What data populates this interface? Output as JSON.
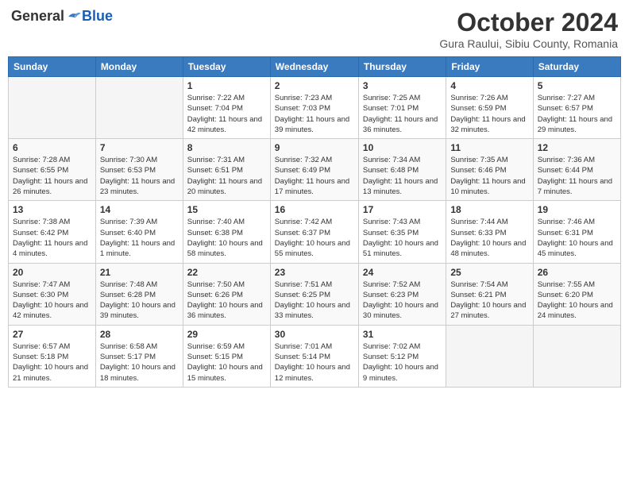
{
  "header": {
    "logo_general": "General",
    "logo_blue": "Blue",
    "month_title": "October 2024",
    "subtitle": "Gura Raului, Sibiu County, Romania"
  },
  "days_of_week": [
    "Sunday",
    "Monday",
    "Tuesday",
    "Wednesday",
    "Thursday",
    "Friday",
    "Saturday"
  ],
  "weeks": [
    [
      {
        "day": "",
        "empty": true
      },
      {
        "day": "",
        "empty": true
      },
      {
        "day": "1",
        "sunrise": "7:22 AM",
        "sunset": "7:04 PM",
        "daylight": "11 hours and 42 minutes."
      },
      {
        "day": "2",
        "sunrise": "7:23 AM",
        "sunset": "7:03 PM",
        "daylight": "11 hours and 39 minutes."
      },
      {
        "day": "3",
        "sunrise": "7:25 AM",
        "sunset": "7:01 PM",
        "daylight": "11 hours and 36 minutes."
      },
      {
        "day": "4",
        "sunrise": "7:26 AM",
        "sunset": "6:59 PM",
        "daylight": "11 hours and 32 minutes."
      },
      {
        "day": "5",
        "sunrise": "7:27 AM",
        "sunset": "6:57 PM",
        "daylight": "11 hours and 29 minutes."
      }
    ],
    [
      {
        "day": "6",
        "sunrise": "7:28 AM",
        "sunset": "6:55 PM",
        "daylight": "11 hours and 26 minutes."
      },
      {
        "day": "7",
        "sunrise": "7:30 AM",
        "sunset": "6:53 PM",
        "daylight": "11 hours and 23 minutes."
      },
      {
        "day": "8",
        "sunrise": "7:31 AM",
        "sunset": "6:51 PM",
        "daylight": "11 hours and 20 minutes."
      },
      {
        "day": "9",
        "sunrise": "7:32 AM",
        "sunset": "6:49 PM",
        "daylight": "11 hours and 17 minutes."
      },
      {
        "day": "10",
        "sunrise": "7:34 AM",
        "sunset": "6:48 PM",
        "daylight": "11 hours and 13 minutes."
      },
      {
        "day": "11",
        "sunrise": "7:35 AM",
        "sunset": "6:46 PM",
        "daylight": "11 hours and 10 minutes."
      },
      {
        "day": "12",
        "sunrise": "7:36 AM",
        "sunset": "6:44 PM",
        "daylight": "11 hours and 7 minutes."
      }
    ],
    [
      {
        "day": "13",
        "sunrise": "7:38 AM",
        "sunset": "6:42 PM",
        "daylight": "11 hours and 4 minutes."
      },
      {
        "day": "14",
        "sunrise": "7:39 AM",
        "sunset": "6:40 PM",
        "daylight": "11 hours and 1 minute."
      },
      {
        "day": "15",
        "sunrise": "7:40 AM",
        "sunset": "6:38 PM",
        "daylight": "10 hours and 58 minutes."
      },
      {
        "day": "16",
        "sunrise": "7:42 AM",
        "sunset": "6:37 PM",
        "daylight": "10 hours and 55 minutes."
      },
      {
        "day": "17",
        "sunrise": "7:43 AM",
        "sunset": "6:35 PM",
        "daylight": "10 hours and 51 minutes."
      },
      {
        "day": "18",
        "sunrise": "7:44 AM",
        "sunset": "6:33 PM",
        "daylight": "10 hours and 48 minutes."
      },
      {
        "day": "19",
        "sunrise": "7:46 AM",
        "sunset": "6:31 PM",
        "daylight": "10 hours and 45 minutes."
      }
    ],
    [
      {
        "day": "20",
        "sunrise": "7:47 AM",
        "sunset": "6:30 PM",
        "daylight": "10 hours and 42 minutes."
      },
      {
        "day": "21",
        "sunrise": "7:48 AM",
        "sunset": "6:28 PM",
        "daylight": "10 hours and 39 minutes."
      },
      {
        "day": "22",
        "sunrise": "7:50 AM",
        "sunset": "6:26 PM",
        "daylight": "10 hours and 36 minutes."
      },
      {
        "day": "23",
        "sunrise": "7:51 AM",
        "sunset": "6:25 PM",
        "daylight": "10 hours and 33 minutes."
      },
      {
        "day": "24",
        "sunrise": "7:52 AM",
        "sunset": "6:23 PM",
        "daylight": "10 hours and 30 minutes."
      },
      {
        "day": "25",
        "sunrise": "7:54 AM",
        "sunset": "6:21 PM",
        "daylight": "10 hours and 27 minutes."
      },
      {
        "day": "26",
        "sunrise": "7:55 AM",
        "sunset": "6:20 PM",
        "daylight": "10 hours and 24 minutes."
      }
    ],
    [
      {
        "day": "27",
        "sunrise": "6:57 AM",
        "sunset": "5:18 PM",
        "daylight": "10 hours and 21 minutes."
      },
      {
        "day": "28",
        "sunrise": "6:58 AM",
        "sunset": "5:17 PM",
        "daylight": "10 hours and 18 minutes."
      },
      {
        "day": "29",
        "sunrise": "6:59 AM",
        "sunset": "5:15 PM",
        "daylight": "10 hours and 15 minutes."
      },
      {
        "day": "30",
        "sunrise": "7:01 AM",
        "sunset": "5:14 PM",
        "daylight": "10 hours and 12 minutes."
      },
      {
        "day": "31",
        "sunrise": "7:02 AM",
        "sunset": "5:12 PM",
        "daylight": "10 hours and 9 minutes."
      },
      {
        "day": "",
        "empty": true
      },
      {
        "day": "",
        "empty": true
      }
    ]
  ]
}
